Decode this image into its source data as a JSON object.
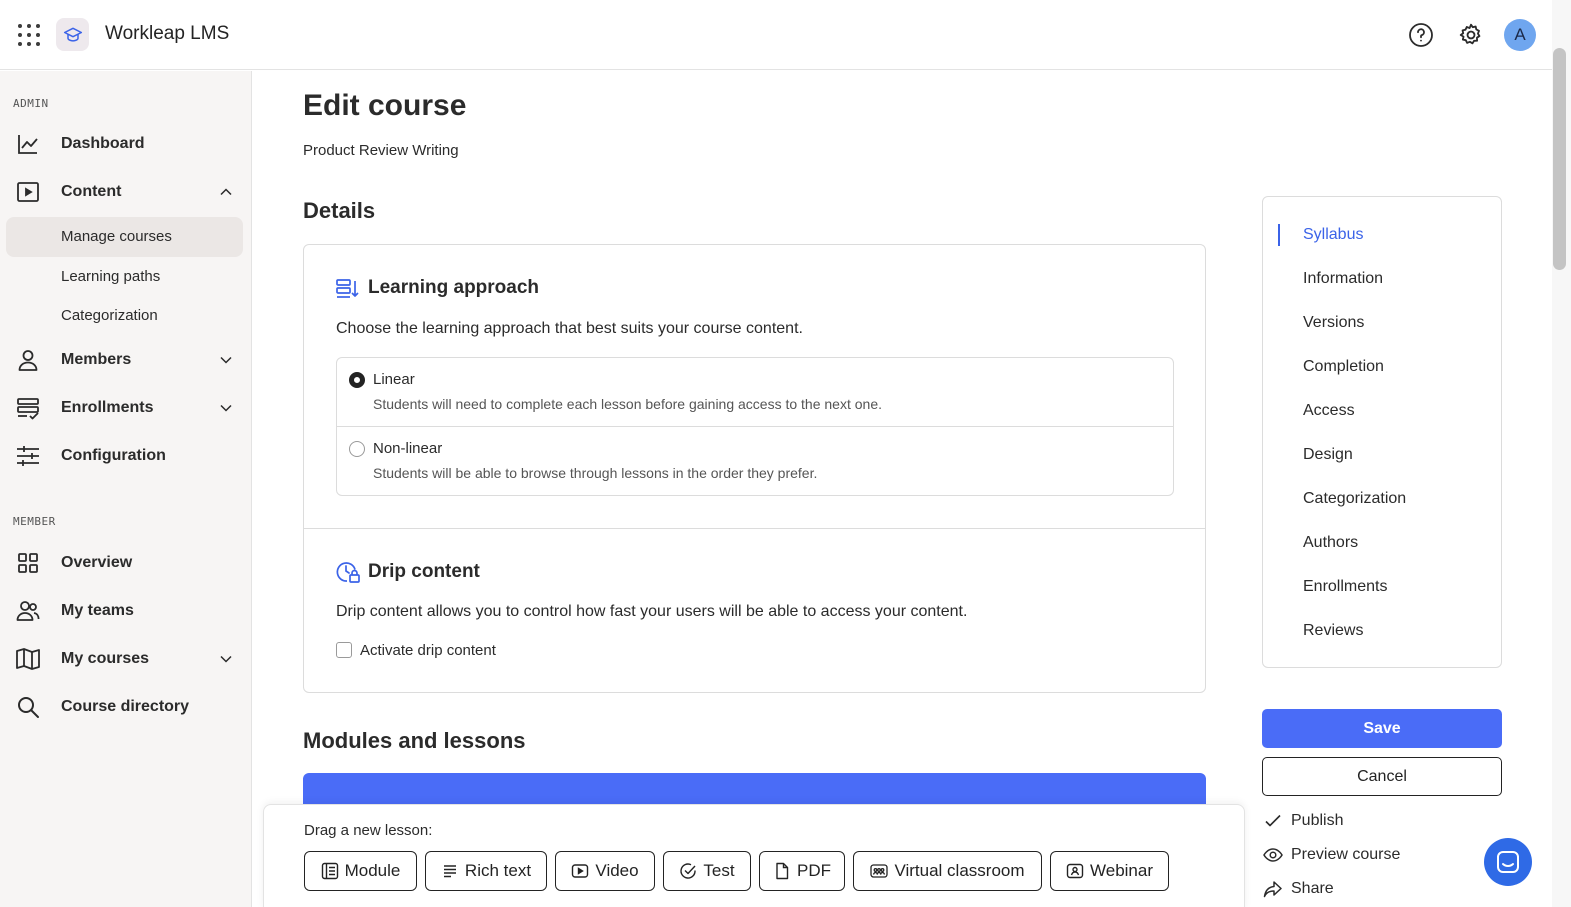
{
  "header": {
    "app_title": "Workleap LMS",
    "avatar_initial": "A",
    "icons": [
      "app-launcher-icon",
      "graduation-cap-icon",
      "help-icon",
      "gear-icon"
    ]
  },
  "sidebar": {
    "admin_label": "ADMIN",
    "member_label": "MEMBER",
    "admin_items": [
      {
        "label": "Dashboard",
        "icon": "chart-line-icon"
      },
      {
        "label": "Content",
        "icon": "play-box-icon",
        "expanded": true
      },
      {
        "label": "Members",
        "icon": "user-icon"
      },
      {
        "label": "Enrollments",
        "icon": "list-check-icon"
      },
      {
        "label": "Configuration",
        "icon": "sliders-icon"
      }
    ],
    "content_sub_items": [
      {
        "label": "Manage courses",
        "active": true
      },
      {
        "label": "Learning paths"
      },
      {
        "label": "Categorization"
      }
    ],
    "member_items": [
      {
        "label": "Overview",
        "icon": "grid-icon"
      },
      {
        "label": "My teams",
        "icon": "users-icon"
      },
      {
        "label": "My courses",
        "icon": "book-open-icon"
      },
      {
        "label": "Course directory",
        "icon": "search-icon"
      }
    ]
  },
  "main": {
    "title": "Edit course",
    "subtitle": "Product Review Writing",
    "details_heading": "Details",
    "learning_approach": {
      "heading": "Learning approach",
      "description": "Choose the learning approach that best suits your course content.",
      "options": [
        {
          "label": "Linear",
          "help": "Students will need to complete each lesson before gaining access to the next one.",
          "checked": true
        },
        {
          "label": "Non-linear",
          "help": "Students will be able to browse through lessons in the order they prefer.",
          "checked": false
        }
      ]
    },
    "drip_content": {
      "heading": "Drip content",
      "description": "Drip content allows you to control how fast your users will be able to access your content.",
      "checkbox_label": "Activate drip content",
      "checked": false
    },
    "modules_heading": "Modules and lessons",
    "drag_panel": {
      "label": "Drag a new lesson:",
      "buttons": [
        {
          "label": "Module",
          "icon": "module-icon"
        },
        {
          "label": "Rich text",
          "icon": "text-lines-icon"
        },
        {
          "label": "Video",
          "icon": "video-icon"
        },
        {
          "label": "Test",
          "icon": "check-circle-icon"
        },
        {
          "label": "PDF",
          "icon": "file-icon"
        },
        {
          "label": "Virtual classroom",
          "icon": "virtual-classroom-icon"
        },
        {
          "label": "Webinar",
          "icon": "webinar-icon"
        }
      ]
    }
  },
  "toc": {
    "items": [
      "Syllabus",
      "Information",
      "Versions",
      "Completion",
      "Access",
      "Design",
      "Categorization",
      "Authors",
      "Enrollments",
      "Reviews"
    ],
    "active": "Syllabus"
  },
  "actions": {
    "save_label": "Save",
    "cancel_label": "Cancel",
    "publish_label": "Publish",
    "preview_label": "Preview course",
    "share_label": "Share"
  },
  "colors": {
    "accent": "#4a6cf7",
    "toc_active": "#3b63e8",
    "sidebar_bg": "#f7f5f4",
    "chat_fab": "#2f6ae6"
  }
}
